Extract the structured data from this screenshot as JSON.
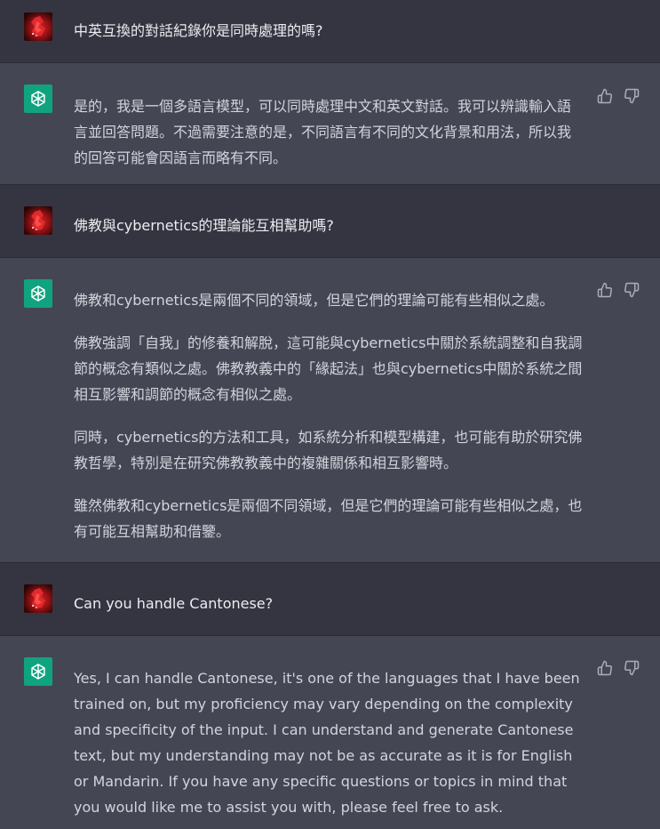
{
  "conversation": [
    {
      "role": "user",
      "avatar": "user-avatar",
      "text": "中英互換的對話紀錄你是同時處理的嗎?"
    },
    {
      "role": "assistant",
      "avatar": "chatgpt-logo-icon",
      "paragraphs": [
        "是的，我是一個多語言模型，可以同時處理中文和英文對話。我可以辨識輸入語言並回答問題。不過需要注意的是，不同語言有不同的文化背景和用法，所以我的回答可能會因語言而略有不同。"
      ]
    },
    {
      "role": "user",
      "avatar": "user-avatar",
      "text": "佛教與cybernetics的理論能互相幫助嗎?"
    },
    {
      "role": "assistant",
      "avatar": "chatgpt-logo-icon",
      "paragraphs": [
        "佛教和cybernetics是兩個不同的領域，但是它們的理論可能有些相似之處。",
        "佛教強調「自我」的修養和解脫，這可能與cybernetics中關於系統調整和自我調節的概念有類似之處。佛教教義中的「緣起法」也與cybernetics中關於系統之間相互影響和調節的概念有相似之處。",
        "同時，cybernetics的方法和工具，如系統分析和模型構建，也可能有助於研究佛教哲學，特別是在研究佛教教義中的複雜關係和相互影響時。",
        "雖然佛教和cybernetics是兩個不同領域，但是它們的理論可能有些相似之處，也有可能互相幫助和借鑒。"
      ]
    },
    {
      "role": "user",
      "avatar": "user-avatar",
      "text": "Can you handle Cantonese?"
    },
    {
      "role": "assistant",
      "avatar": "chatgpt-logo-icon",
      "paragraphs": [
        "Yes, I can handle Cantonese, it's one of the languages that I have been trained on, but my proficiency may vary depending on the complexity and specificity of the input. I can understand and generate Cantonese text, but my understanding may not be as accurate as it is for English or Mandarin. If you have any specific questions or topics in mind that you would like me to assist you with, please feel free to ask."
      ]
    }
  ],
  "feedback_icons": [
    "thumbs-up-icon",
    "thumbs-down-icon"
  ],
  "colors": {
    "user_bg": "#343541",
    "assistant_bg": "#444654",
    "bot_avatar": "#10a37f",
    "text": "#d1d5db"
  }
}
